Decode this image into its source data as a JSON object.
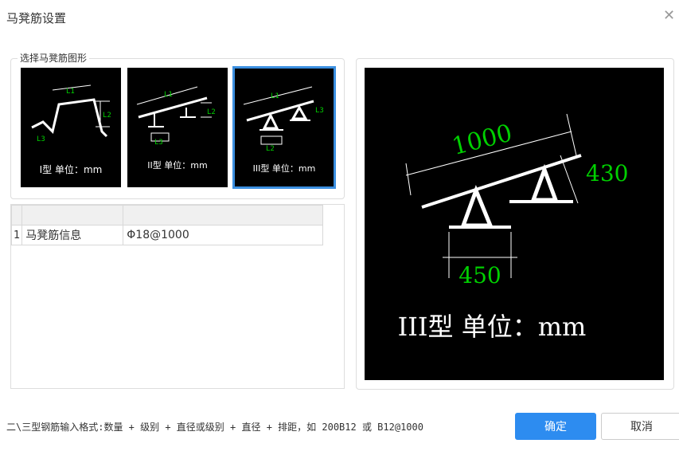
{
  "dialog": {
    "title": "马凳筋设置",
    "close_icon": "close-icon"
  },
  "shape_group": {
    "label": "选择马凳筋图形",
    "options": [
      {
        "name": "I型",
        "caption": "I型 单位：mm",
        "dims": [
          "L1",
          "L2",
          "L3"
        ],
        "selected": false
      },
      {
        "name": "II型",
        "caption": "II型 单位：mm",
        "dims": [
          "L1",
          "L2",
          "L3"
        ],
        "selected": false
      },
      {
        "name": "III型",
        "caption": "III型 单位：mm",
        "dims": [
          "L1",
          "L2",
          "L3"
        ],
        "selected": true
      }
    ]
  },
  "table": {
    "rows": [
      {
        "index": "1",
        "name": "马凳筋信息",
        "value": "Φ18@1000"
      }
    ]
  },
  "preview": {
    "dim_top": "1000",
    "dim_right": "430",
    "dim_bottom": "450",
    "caption": "III型 单位：mm"
  },
  "footer": {
    "hint": "二\\三型钢筋输入格式:数量 + 级别 + 直径或级别 + 直径 + 排距，如 200B12 或 B12@1000",
    "ok_label": "确定",
    "cancel_label": "取消"
  },
  "colors": {
    "primary": "#2d8cf0",
    "dimension_green": "#00d000",
    "selected_border": "#3b8fe0"
  }
}
